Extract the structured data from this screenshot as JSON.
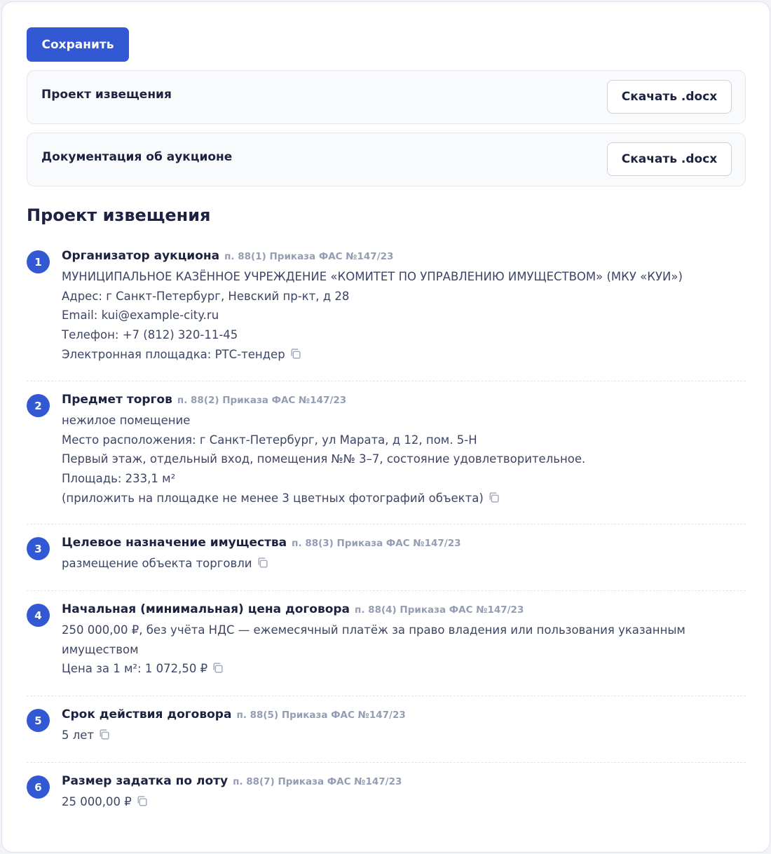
{
  "toolbar": {
    "save_label": "Сохранить"
  },
  "documents": [
    {
      "title": "Проект извещения",
      "download_label": "Скачать .docx"
    },
    {
      "title": "Документация об аукционе",
      "download_label": "Скачать .docx"
    }
  ],
  "section": {
    "title": "Проект извещения"
  },
  "items": [
    {
      "number": "1",
      "title": "Организатор аукциона",
      "ref": "п. 88(1) Приказа ФАС №147/23",
      "lines": [
        "МУНИЦИПАЛЬНОЕ КАЗЁННОЕ УЧРЕЖДЕНИЕ «КОМИТЕТ ПО УПРАВЛЕНИЮ ИМУЩЕСТВОМ» (МКУ «КУИ»)",
        "Адрес: г Санкт-Петербург, Невский пр-кт, д 28",
        "Email: kui@example-city.ru",
        "Телефон: +7 (812) 320-11-45",
        "Электронная площадка: РТС-тендер"
      ]
    },
    {
      "number": "2",
      "title": "Предмет торгов",
      "ref": "п. 88(2) Приказа ФАС №147/23",
      "lines": [
        "нежилое помещение",
        "Место расположения: г Санкт-Петербург, ул Марата, д 12, пом. 5-Н",
        "Первый этаж, отдельный вход, помещения №№ 3–7, состояние удовлетворительное.",
        "Площадь: 233,1 м²",
        "(приложить на площадке не менее 3 цветных фотографий объекта)"
      ]
    },
    {
      "number": "3",
      "title": "Целевое назначение имущества",
      "ref": "п. 88(3) Приказа ФАС №147/23",
      "lines": [
        "размещение объекта торговли"
      ]
    },
    {
      "number": "4",
      "title": "Начальная (минимальная) цена договора",
      "ref": "п. 88(4) Приказа ФАС №147/23",
      "lines": [
        "250 000,00 ₽, без учёта НДС — ежемесячный платёж за право владения или пользования указанным",
        "имуществом",
        "Цена за 1 м²: 1 072,50 ₽"
      ]
    },
    {
      "number": "5",
      "title": "Срок действия договора",
      "ref": "п. 88(5) Приказа ФАС №147/23",
      "lines": [
        "5 лет"
      ]
    },
    {
      "number": "6",
      "title": "Размер задатка по лоту",
      "ref": "п. 88(7) Приказа ФАС №147/23",
      "lines": [
        "25 000,00 ₽"
      ]
    }
  ],
  "icons": {
    "copy": "copy-icon"
  },
  "colors": {
    "accent": "#3358d4",
    "text": "#1c2240",
    "muted": "#949db3"
  }
}
